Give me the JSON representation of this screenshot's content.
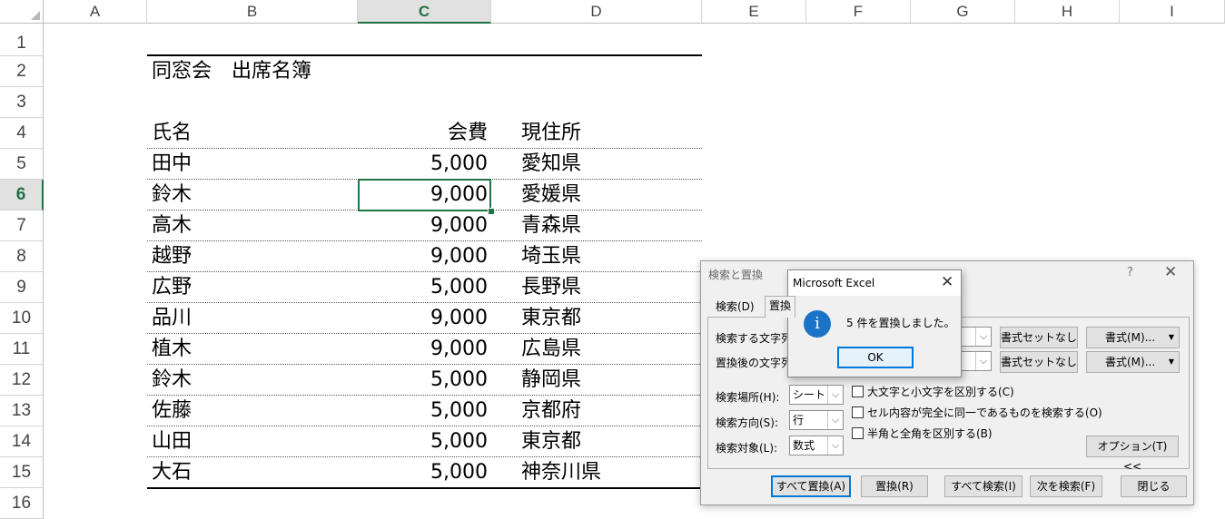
{
  "columns": [
    "A",
    "B",
    "C",
    "D",
    "E",
    "F",
    "G",
    "H",
    "I"
  ],
  "rows": [
    "1",
    "2",
    "3",
    "4",
    "5",
    "6",
    "7",
    "8",
    "9",
    "10",
    "11",
    "12",
    "13",
    "14",
    "15",
    "16"
  ],
  "sheet": {
    "title": "同窓会　出席名簿",
    "headers": {
      "name": "氏名",
      "fee": "会費",
      "address": "現住所"
    },
    "records": [
      {
        "name": "田中",
        "fee": "5,000",
        "address": "愛知県"
      },
      {
        "name": "鈴木",
        "fee": "9,000",
        "address": "愛媛県"
      },
      {
        "name": "高木",
        "fee": "9,000",
        "address": "青森県"
      },
      {
        "name": "越野",
        "fee": "9,000",
        "address": "埼玉県"
      },
      {
        "name": "広野",
        "fee": "5,000",
        "address": "長野県"
      },
      {
        "name": "品川",
        "fee": "9,000",
        "address": "東京都"
      },
      {
        "name": "植木",
        "fee": "9,000",
        "address": "広島県"
      },
      {
        "name": "鈴木",
        "fee": "5,000",
        "address": "静岡県"
      },
      {
        "name": "佐藤",
        "fee": "5,000",
        "address": "京都府"
      },
      {
        "name": "山田",
        "fee": "5,000",
        "address": "東京都"
      },
      {
        "name": "大石",
        "fee": "5,000",
        "address": "神奈川県"
      }
    ]
  },
  "find_replace": {
    "title": "検索と置換",
    "help": "?",
    "close": "✕",
    "tabs": {
      "find": "検索(D)",
      "replace": "置換"
    },
    "find_label": "検索する文字列",
    "replace_label": "置換後の文字列",
    "no_format_1": "書式セットなし",
    "no_format_2": "書式セットなし",
    "format_1": "書式(M)...",
    "format_2": "書式(M)...",
    "within_label": "検索場所(H):",
    "within_value": "シート",
    "search_label": "検索方向(S):",
    "search_value": "行",
    "lookin_label": "検索対象(L):",
    "lookin_value": "数式",
    "match_case": "大文字と小文字を区別する(C)",
    "match_entire": "セル内容が完全に同一であるものを検索する(O)",
    "match_byte": "半角と全角を区別する(B)",
    "options": "オプション(T) <<",
    "replace_all": "すべて置換(A)",
    "replace": "置換(R)",
    "find_all": "すべて検索(I)",
    "find_next": "次を検索(F)",
    "close_btn": "閉じる"
  },
  "message_box": {
    "title": "Microsoft Excel",
    "close": "✕",
    "icon_glyph": "i",
    "text": "5 件を置換しました。",
    "ok": "OK"
  }
}
